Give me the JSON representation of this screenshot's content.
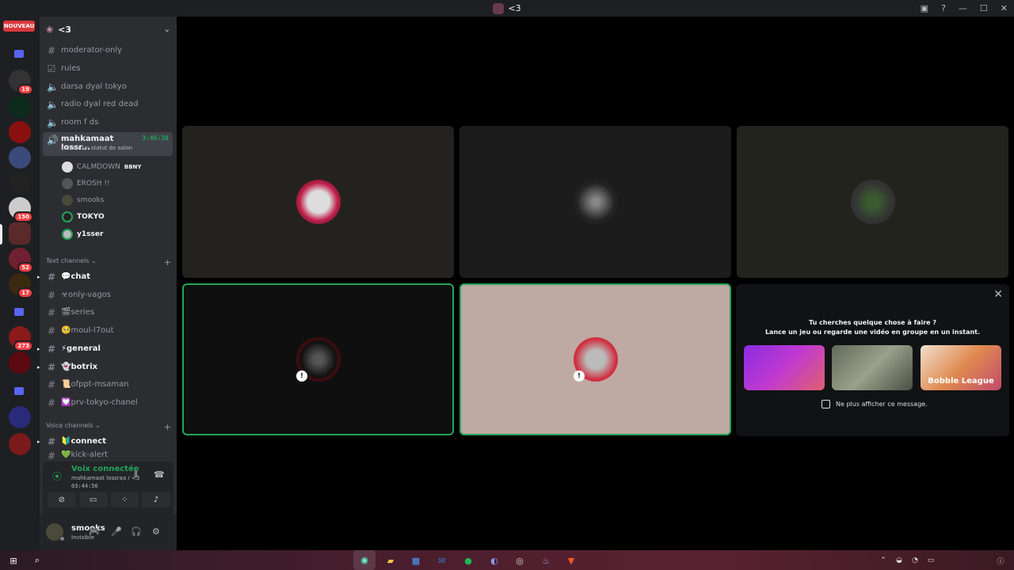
{
  "window": {
    "title": "<3",
    "controls": [
      "inbox-icon",
      "help-icon",
      "minimize-icon",
      "maximize-icon",
      "close-icon"
    ]
  },
  "server_rail": {
    "new_badge": "NOUVEAU",
    "badges": [
      "19",
      "150",
      "52",
      "17",
      "273"
    ]
  },
  "server": {
    "name": "<3"
  },
  "channels": [
    {
      "name": "moderator-only",
      "type": "text"
    },
    {
      "name": "rules",
      "type": "rules"
    },
    {
      "name": "darsa dyal tokyo",
      "type": "voice"
    },
    {
      "name": "radio dyal red dead",
      "type": "voice"
    },
    {
      "name": "room f ds",
      "type": "voice"
    }
  ],
  "active_voice": {
    "name": "mahkamaat lossr...",
    "time": "3:46:38",
    "status": "Définir un statut de salon"
  },
  "voice_users": [
    {
      "name": "CALMDOWN",
      "tag": "BBNY"
    },
    {
      "name": "EROSH !!"
    },
    {
      "name": "smooks"
    },
    {
      "name": "TOKYO"
    },
    {
      "name": "y1sser"
    }
  ],
  "text_category": "Text channels",
  "text_channels": [
    {
      "name": "💬chat",
      "unread": true
    },
    {
      "name": "☣only-vagos",
      "unread": false
    },
    {
      "name": "🎬series",
      "unread": false
    },
    {
      "name": "🥺moul-l7out",
      "unread": false
    },
    {
      "name": "⚡general",
      "unread": true
    },
    {
      "name": "👻botrix",
      "unread": true
    },
    {
      "name": "📜ofppt-msaman",
      "unread": false
    },
    {
      "name": "💟prv-tokyo-chanel",
      "unread": false
    }
  ],
  "voice_category": "Voice channels",
  "voice_channels": [
    {
      "name": "🔰connect",
      "unread": true
    },
    {
      "name": "💚kick-alert",
      "unread": false
    }
  ],
  "voice_panel": {
    "status": "Voix connectée",
    "location": "mahkamaat lossraa / <3",
    "elapsed": "03:44:56"
  },
  "user": {
    "name": "smooks",
    "status": "Invisible"
  },
  "activity": {
    "line1": "Tu cherches quelque chose à faire ?",
    "line2": "Lance un jeu ou regarde une vidéo en groupe en un instant.",
    "games": [
      "",
      "",
      "Bobble League"
    ],
    "dont_show": "Ne plus afficher ce message."
  },
  "colors": {
    "accent": "#5865f2",
    "speaking": "#23a559",
    "danger": "#f23f43"
  }
}
